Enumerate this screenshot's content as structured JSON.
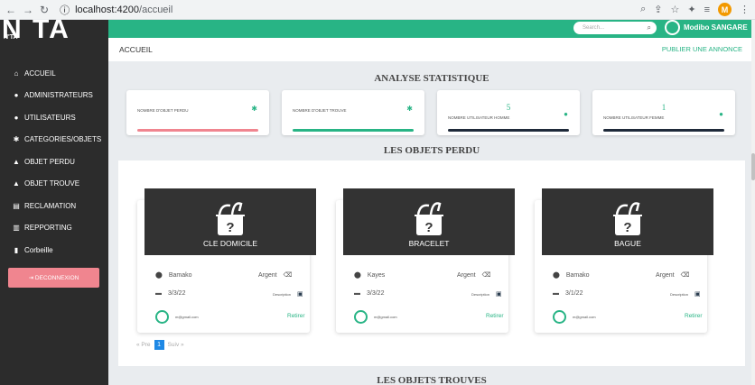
{
  "browser": {
    "url_host": "localhost:4200",
    "url_path": "/accueil",
    "profile_initial": "M"
  },
  "logo": {
    "text": "N TA",
    "small": "N'TA"
  },
  "topbar": {
    "search_placeholder": "Search...",
    "user_name": "Modibo SANGARE"
  },
  "sidebar": {
    "items": [
      {
        "label": "ACCUEIL",
        "icon": "home-icon",
        "glyph": "⌂"
      },
      {
        "label": "ADMINISTRATEURS",
        "icon": "user-icon",
        "glyph": "●"
      },
      {
        "label": "UTILISATEURS",
        "icon": "users-icon",
        "glyph": "●"
      },
      {
        "label": "CATEGORIES/OBJETS",
        "icon": "tags-icon",
        "glyph": "✱"
      },
      {
        "label": "OBJET PERDU",
        "icon": "bag-icon",
        "glyph": "▲"
      },
      {
        "label": "OBJET TROUVE",
        "icon": "bag-icon",
        "glyph": "▲"
      },
      {
        "label": "RECLAMATION",
        "icon": "table-icon",
        "glyph": "▤"
      },
      {
        "label": "REPPORTING",
        "icon": "chart-icon",
        "glyph": "▥"
      },
      {
        "label": "Corbeille",
        "icon": "trash-icon",
        "glyph": "▮"
      }
    ],
    "logout": "DECONNEXION"
  },
  "header": {
    "title": "ACCUEIL",
    "publish": "PUBLIER UNE ANNONCE"
  },
  "stats": {
    "title": "ANALYSE STATISTIQUE",
    "cards": [
      {
        "label": "NOMBRE D'OBJET PERDU",
        "value": "",
        "bar": "#f0858f"
      },
      {
        "label": "NOMBRE D'OBJET TROUVE",
        "value": "",
        "bar": "#28b485"
      },
      {
        "label": "NOMBRE UTILISATEUR HOMME",
        "value": "5",
        "bar": "#1f2a3a"
      },
      {
        "label": "NOMBRE UTILISATEUR FEMME",
        "value": "1",
        "bar": "#1f2a3a"
      }
    ]
  },
  "lost": {
    "title": "LES OBJETS PERDU",
    "cards": [
      {
        "name": "CLE DOMICILE",
        "city": "Bamako",
        "category": "Argent",
        "date": "3/3/22",
        "desc": "Description",
        "email": "m@gmail.com",
        "action": "Retirer"
      },
      {
        "name": "BRACELET",
        "city": "Kayes",
        "category": "Argent",
        "date": "3/3/22",
        "desc": "Description",
        "email": "m@gmail.com",
        "action": "Retirer"
      },
      {
        "name": "BAGUE",
        "city": "Bamako",
        "category": "Argent",
        "date": "3/1/22",
        "desc": "Description",
        "email": "m@gmail.com",
        "action": "Retirer"
      }
    ],
    "pager": {
      "prev": "« Pre",
      "current": "1",
      "next": "Suiv »"
    }
  },
  "found": {
    "title": "LES OBJETS TROUVES"
  }
}
